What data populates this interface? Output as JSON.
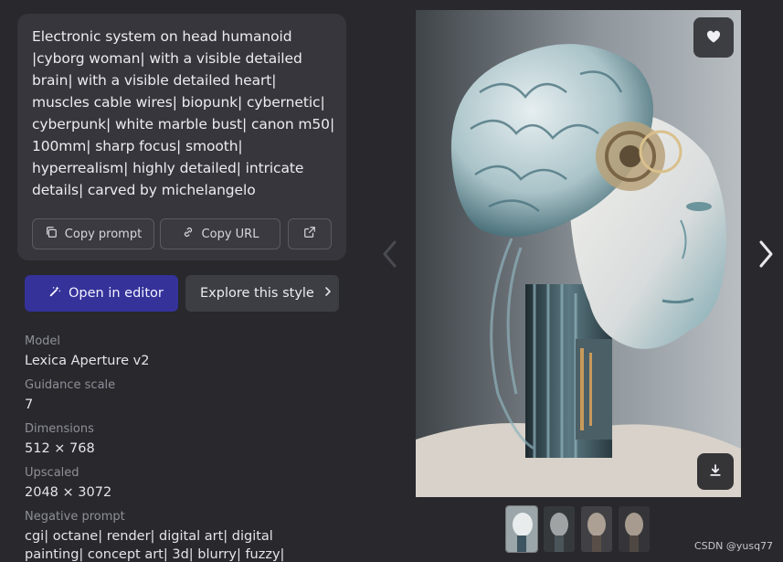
{
  "prompt": {
    "text": "Electronic system on head humanoid |cyborg woman| with a visible detailed brain| with a visible detailed heart| muscles cable wires| biopunk| cybernetic| cyberpunk| white marble bust| canon m50| 100mm| sharp focus| smooth| hyperrealism| highly detailed| intricate details| carved by michelangelo",
    "copy_prompt_label": "Copy prompt",
    "copy_url_label": "Copy URL",
    "open_external_icon": "external-link-icon"
  },
  "actions": {
    "open_editor_label": "Open in editor",
    "explore_style_label": "Explore this style",
    "accent_color": "#35329a"
  },
  "metadata": [
    {
      "label": "Model",
      "value": "Lexica Aperture v2"
    },
    {
      "label": "Guidance scale",
      "value": "7"
    },
    {
      "label": "Dimensions",
      "value": "512 × 768"
    },
    {
      "label": "Upscaled",
      "value": "2048 × 3072"
    },
    {
      "label": "Negative prompt",
      "value": "cgi| octane| render| digital art| digital painting| concept art| 3d| blurry| fuzzy| disfigured|"
    }
  ],
  "viewer": {
    "favorite_icon": "heart-icon",
    "download_icon": "download-icon",
    "prev_icon": "chevron-left-icon",
    "next_icon": "chevron-right-icon",
    "thumbnail_count": 4,
    "active_thumbnail": 1
  },
  "watermark": "CSDN @yusq77"
}
